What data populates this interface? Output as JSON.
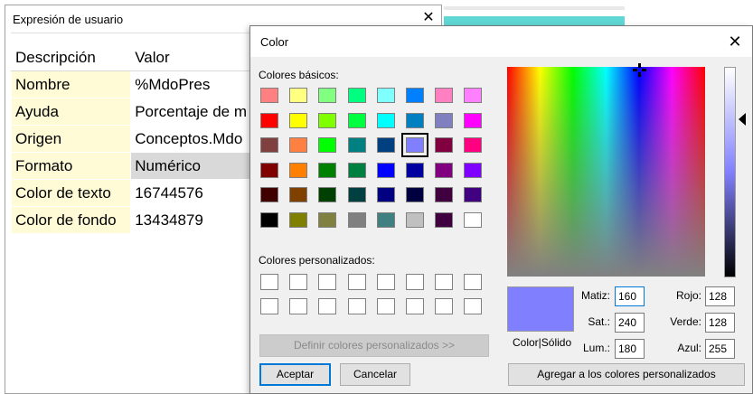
{
  "background_window": {
    "title": "Expresión de usuario",
    "close_glyph": "✕",
    "table": {
      "headers": [
        "Descripción",
        "Valor"
      ],
      "rows": [
        {
          "key": "Nombre",
          "value": "%MdoPres"
        },
        {
          "key": "Ayuda",
          "value": "Porcentaje de m"
        },
        {
          "key": "Origen",
          "value": "Conceptos.Mdo"
        },
        {
          "key": "Formato",
          "value": "Numérico"
        },
        {
          "key": "Color de texto",
          "value": "16744576"
        },
        {
          "key": "Color de fondo",
          "value": "13434879"
        }
      ]
    }
  },
  "dialog": {
    "title": "Color",
    "close_glyph": "✕",
    "basic_label": "Colores básicos:",
    "custom_label": "Colores personalizados:",
    "basic_colors": [
      [
        "#ff8080",
        "#ffff80",
        "#80ff80",
        "#00ff80",
        "#80ffff",
        "#0080ff",
        "#ff80c0",
        "#ff80ff"
      ],
      [
        "#ff0000",
        "#ffff00",
        "#80ff00",
        "#00ff40",
        "#00ffff",
        "#0080c0",
        "#8080c0",
        "#ff00ff"
      ],
      [
        "#804040",
        "#ff8040",
        "#00ff00",
        "#008080",
        "#004080",
        "#8080ff",
        "#800040",
        "#ff0080"
      ],
      [
        "#800000",
        "#ff8000",
        "#008000",
        "#008040",
        "#0000ff",
        "#0000a0",
        "#800080",
        "#8000ff"
      ],
      [
        "#400000",
        "#804000",
        "#004000",
        "#004040",
        "#000080",
        "#000040",
        "#400040",
        "#400080"
      ],
      [
        "#000000",
        "#808000",
        "#808040",
        "#808080",
        "#408080",
        "#c0c0c0",
        "#400040",
        "#ffffff"
      ]
    ],
    "selected_color": "#8080ff",
    "define_custom_button": "Definir colores personalizados >>",
    "accept_button": "Aceptar",
    "cancel_button": "Cancelar",
    "preview_label": "Color|Sólido",
    "add_custom_button": "Agregar a los colores personalizados",
    "fields": {
      "matiz": {
        "label": "Matiz:",
        "value": "160"
      },
      "sat": {
        "label": "Sat.:",
        "value": "240"
      },
      "lum": {
        "label": "Lum.:",
        "value": "180"
      },
      "rojo": {
        "label": "Rojo:",
        "value": "128"
      },
      "verde": {
        "label": "Verde:",
        "value": "128"
      },
      "azul": {
        "label": "Azul:",
        "value": "255"
      }
    }
  }
}
